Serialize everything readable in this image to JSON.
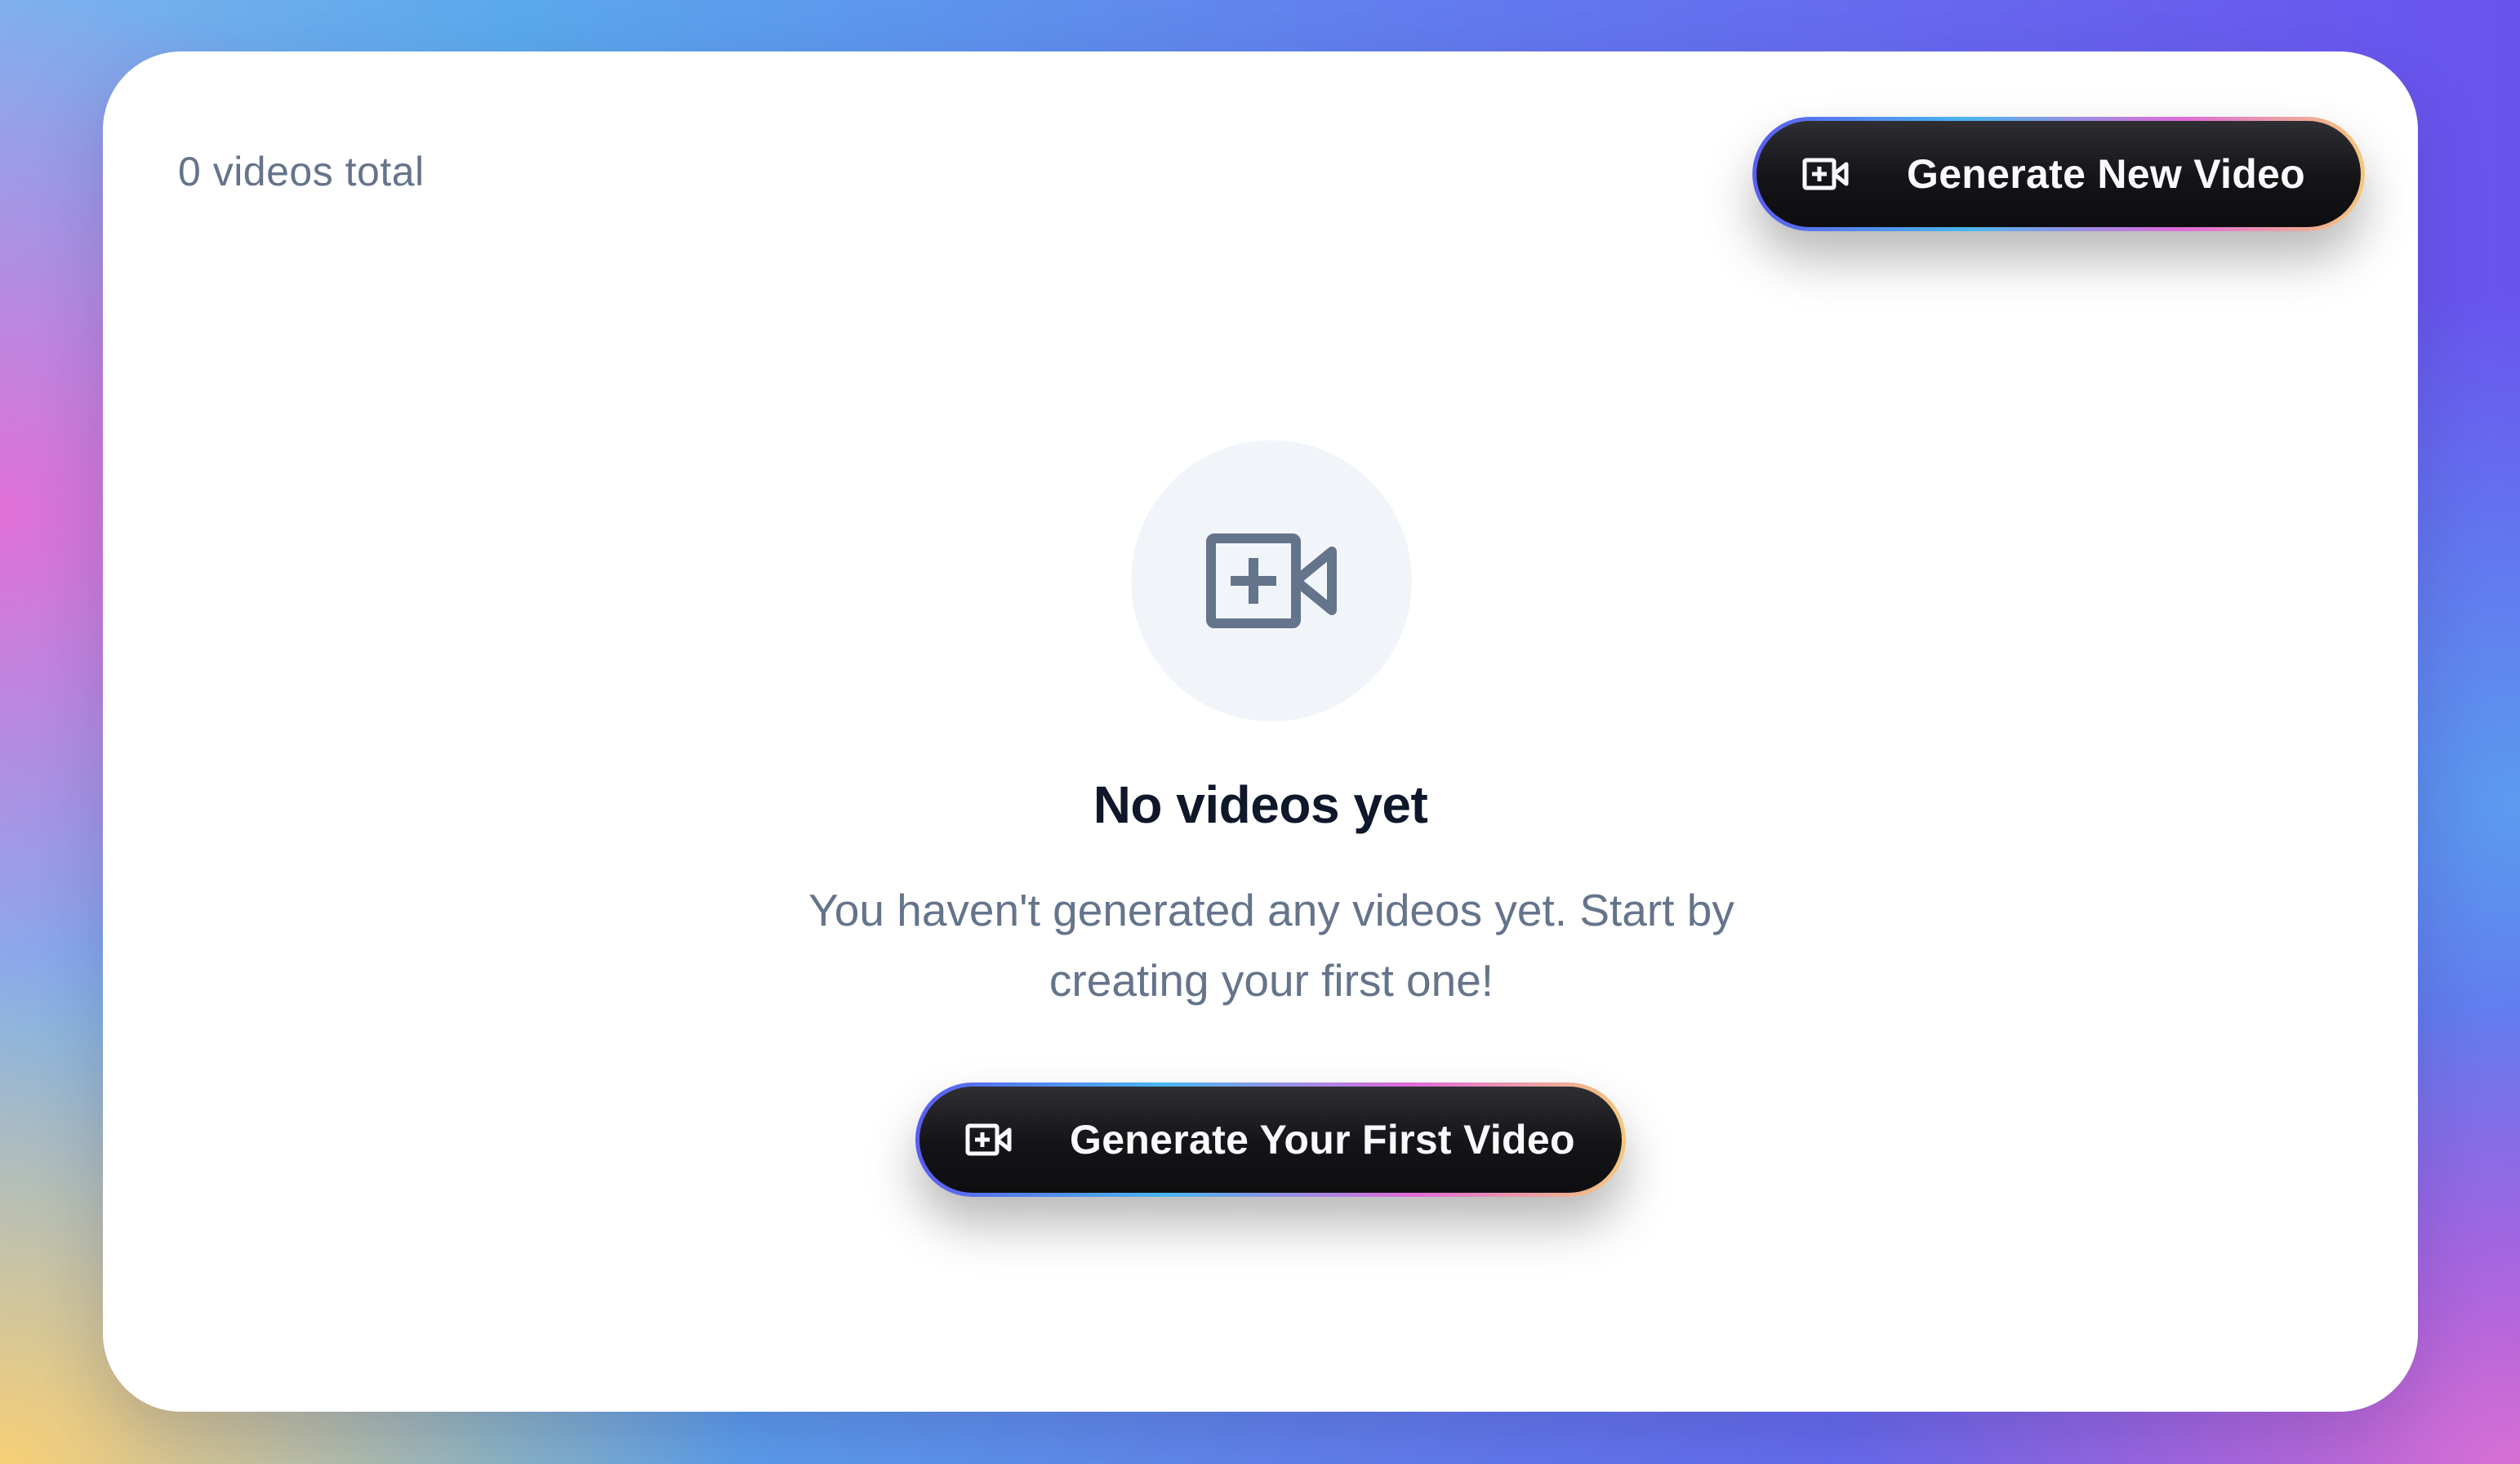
{
  "header": {
    "count_text": "0 videos total",
    "generate_button_label": "Generate New Video"
  },
  "empty_state": {
    "icon": "video-plus-icon",
    "title": "No videos yet",
    "description": "You haven't generated any videos yet. Start by creating your first one!",
    "cta_label": "Generate Your First Video"
  },
  "colors": {
    "button_bg": "#141417",
    "button_text": "#f8fafc",
    "muted_text": "#64748b",
    "title_text": "#0f172a",
    "icon_circle": "#f1f5f9",
    "icon_color": "#64748b",
    "button_border_gradient": [
      "#5b5cf0",
      "#4ab6f0",
      "#e06ad8",
      "#f4c77a"
    ]
  }
}
